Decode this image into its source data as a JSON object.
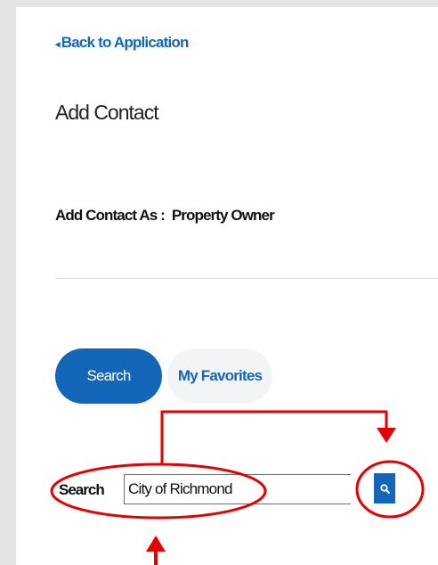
{
  "nav": {
    "back_label": "Back to Application",
    "back_chevron": "◂"
  },
  "page": {
    "title": "Add Contact"
  },
  "contact": {
    "label": "Add Contact As  :",
    "value": "Property Owner"
  },
  "tabs": [
    {
      "label": "Search",
      "active": true
    },
    {
      "label": "My Favorites",
      "active": false
    }
  ],
  "search": {
    "label": "Search",
    "value": "City of Richmond",
    "button_icon": "search-icon"
  },
  "colors": {
    "accent": "#1466b8",
    "annotation": "#e60000",
    "background": "#e4e4e4"
  }
}
